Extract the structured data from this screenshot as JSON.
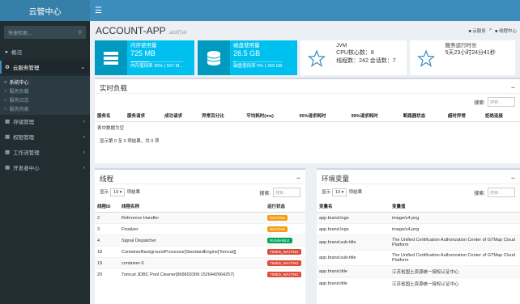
{
  "brand": "云管中心",
  "sidebar": {
    "search_placeholder": "快速检索...",
    "items": [
      {
        "label": "概况"
      },
      {
        "label": "云服务管理"
      },
      {
        "label": "存储管理"
      },
      {
        "label": "权限管理"
      },
      {
        "label": "工作流管理"
      },
      {
        "label": "开发者中心"
      }
    ],
    "sub": [
      "系统中心",
      "服务负载",
      "服务日志",
      "服务列表"
    ]
  },
  "header": {
    "title": "ACCOUNT-APP",
    "subtitle": "add打ell",
    "crumbs": [
      "云服务",
      "线程中心"
    ]
  },
  "stats": [
    {
      "label": "内存使用量",
      "value": "725 MB",
      "sub": "内存使用率 36% ( 567 M...",
      "pct": 0.36
    },
    {
      "label": "磁盘使用量",
      "value": "26.5 GB",
      "sub": "磁盘使用率 5% ( 269 GB",
      "pct": 0.05
    },
    {
      "label": "JVM",
      "l2": "CPU核心数：8",
      "l3": "线程数：242 会话数：7"
    },
    {
      "label": "服务运行时长",
      "l2": "5天23小时24分41秒"
    }
  ],
  "realtime": {
    "title": "实时负载",
    "search_label": "搜索:",
    "search_placeholder": "搜索...",
    "columns": [
      "服务名",
      "服务请求",
      "成功请求",
      "异常百分比",
      "平均耗时(ms)",
      "95%请求耗时",
      "99%请求耗时",
      "断路器状态",
      "超时异常",
      "拒绝连接"
    ],
    "empty": "表中数据为空",
    "info": "显示第 0 至 0 项结果，共 0 项"
  },
  "threads": {
    "title": "线程",
    "show": "显示",
    "show_value": "10",
    "show_suffix": "项结果",
    "search_label": "搜索:",
    "search_placeholder": "搜索...",
    "columns": [
      "线程ID",
      "线程名称",
      "运行状态"
    ],
    "rows": [
      {
        "id": "2",
        "name": "Reference Handler",
        "state": "WAITING",
        "color": "#f39c12"
      },
      {
        "id": "3",
        "name": "Finalizer",
        "state": "WAITING",
        "color": "#f39c12"
      },
      {
        "id": "4",
        "name": "Signal Dispatcher",
        "state": "RUNNABLE",
        "color": "#00a65a"
      },
      {
        "id": "18",
        "name": "ContainerBackgroundProcessor[StandardEngine[Tomcat]]",
        "state": "TIMED_WAITING",
        "color": "#dd4b39"
      },
      {
        "id": "19",
        "name": "container-0",
        "state": "TIMED_WAITING",
        "color": "#dd4b39"
      },
      {
        "id": "20",
        "name": "Tomcat JDBC Pool Cleaner[868693306:1526442664257]",
        "state": "TIMED_WAITING",
        "color": "#dd4b39"
      }
    ]
  },
  "env": {
    "title": "环境变量",
    "show": "显示",
    "show_value": "10",
    "show_suffix": "项结果",
    "search_label": "搜索:",
    "search_placeholder": "搜索...",
    "columns": [
      "变量名",
      "变量值"
    ],
    "rows": [
      {
        "k": "app.brand.logo",
        "v": "image/u4.png"
      },
      {
        "k": "app.brand.logo",
        "v": "image/u4.png"
      },
      {
        "k": "app.brand.sub-title",
        "v": "The Unified Certification Authorization Center of GTMap Cloud Platform"
      },
      {
        "k": "app.brand.sub-title",
        "v": "The Unified Certification Authorization Center of GTMap Cloud Platform"
      },
      {
        "k": "app.brand.title",
        "v": "江苏省国土资源统一授权认证中心"
      },
      {
        "k": "app.brand.title",
        "v": "江苏省国土资源统一授权认证中心"
      }
    ]
  }
}
